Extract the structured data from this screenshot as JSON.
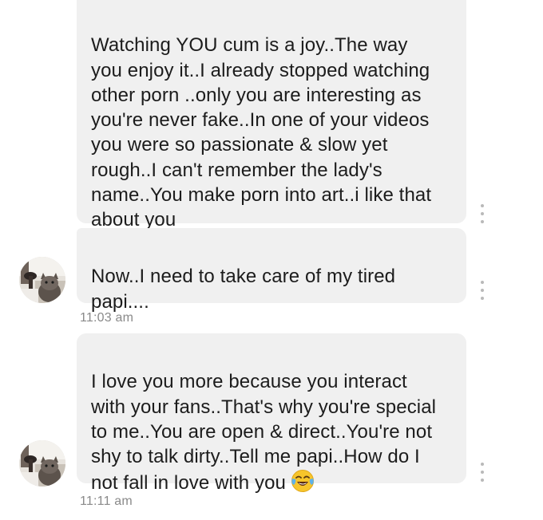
{
  "conversation": {
    "messages": [
      {
        "text": "Watching YOU cum is a joy..The way\nyou enjoy it..I already stopped watching\nother porn ..only you are interesting as\nyou're never fake..In one of your videos\nyou were so passionate & slow yet\nrough..I can't remember the lady's\nname..You make porn into art..i like that\nabout you"
      },
      {
        "text": "Now..I need to take care of my tired\npapi....",
        "timestamp": "11:03 am"
      },
      {
        "text": "I love you more because you interact\nwith your fans..That's why you're special\nto me..You are open & direct..You're not\nshy to talk dirty..Tell me papi..How do I\nnot fall in love with you",
        "emoji": "face-with-tears-of-joy",
        "timestamp": "11:11 am"
      }
    ]
  },
  "colors": {
    "bubble_background": "#f0f0f0",
    "text": "#1c1c1c",
    "timestamp": "#8a8a8a",
    "menu_dots": "#b9b9b9"
  },
  "icons": {
    "message_menu": "vertical-ellipsis-icon",
    "avatar": "cat-photo-avatar"
  }
}
